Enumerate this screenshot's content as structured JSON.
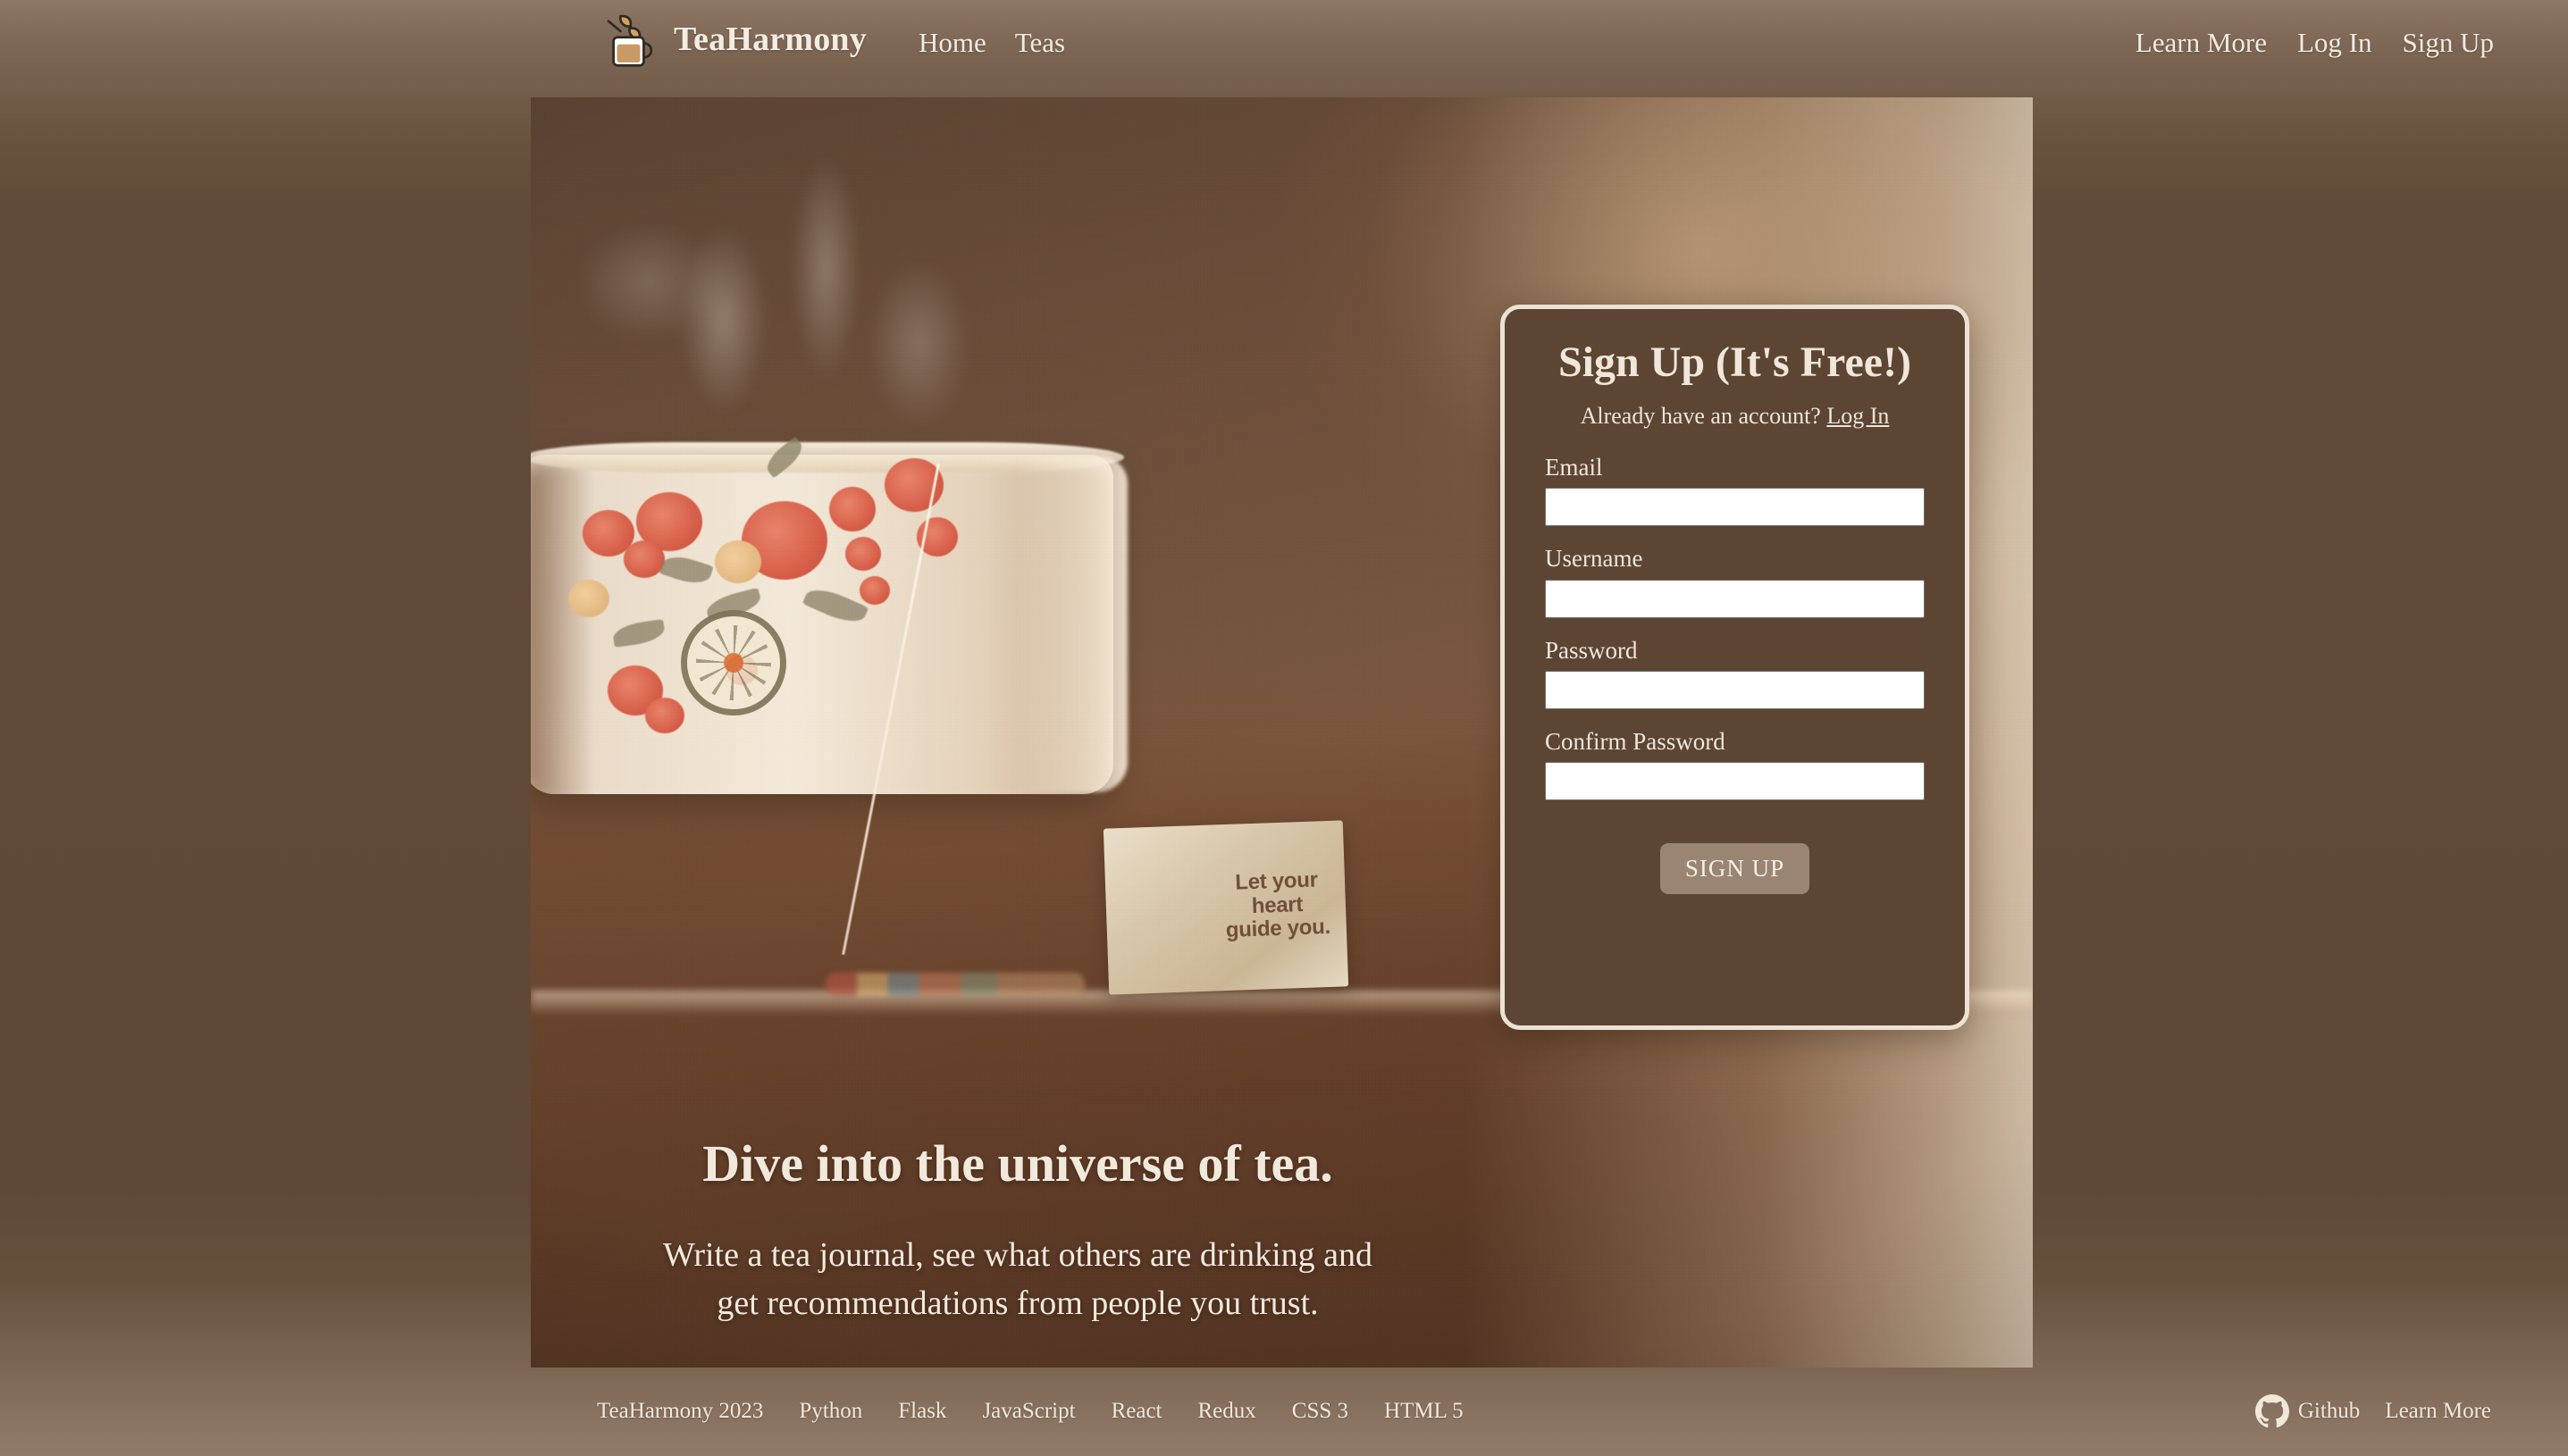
{
  "header": {
    "brand": {
      "name": "TeaHarmony",
      "logo_icon": "tea-cup-leaf-icon"
    },
    "nav_left": [
      {
        "label": "Home"
      },
      {
        "label": "Teas"
      }
    ],
    "nav_right": [
      {
        "label": "Learn More"
      },
      {
        "label": "Log In"
      },
      {
        "label": "Sign Up"
      }
    ]
  },
  "hero": {
    "image_alt": "steaming floral teacup with tea bag",
    "tea_tag_text_line1": "Let your",
    "tea_tag_text_line2": "heart",
    "tea_tag_text_line3": "guide you.",
    "title": "Dive into the universe of tea.",
    "subtitle_line1": "Write a tea journal, see what others are drinking and",
    "subtitle_line2": "get recommendations from people you trust."
  },
  "signup": {
    "title": "Sign Up (It's Free!)",
    "already_text": "Already have an account?",
    "login_link": "Log In",
    "fields": [
      {
        "label": "Email",
        "value": "",
        "placeholder": "",
        "type": "email",
        "name": "email-field"
      },
      {
        "label": "Username",
        "value": "",
        "placeholder": "",
        "type": "text",
        "name": "username-field"
      },
      {
        "label": "Password",
        "value": "",
        "placeholder": "",
        "type": "password",
        "name": "password-field"
      },
      {
        "label": "Confirm Password",
        "value": "",
        "placeholder": "",
        "type": "password",
        "name": "confirm-password-field"
      }
    ],
    "submit_label": "SIGN UP"
  },
  "footer": {
    "copyright": "TeaHarmony 2023",
    "tech": [
      {
        "label": "Python"
      },
      {
        "label": "Flask"
      },
      {
        "label": "JavaScript"
      },
      {
        "label": "React"
      },
      {
        "label": "Redux"
      },
      {
        "label": "CSS 3"
      },
      {
        "label": "HTML 5"
      }
    ],
    "github_label": "Github",
    "github_icon": "github-icon",
    "learn_more": "Learn More"
  },
  "colors": {
    "page_background_top": "#8e7765",
    "page_background_mid": "#5f4836",
    "panel_background": "#5c4533",
    "panel_border": "#ece2d4",
    "text_cream": "#f0e6d9",
    "button_background": "#9a8573",
    "input_background": "#ffffff"
  }
}
